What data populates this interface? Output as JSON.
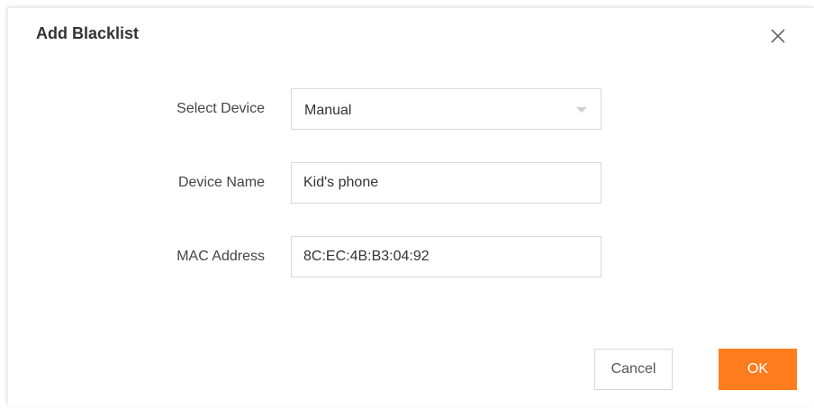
{
  "dialog": {
    "title": "Add Blacklist",
    "close_icon": "close-icon"
  },
  "form": {
    "select_device": {
      "label": "Select Device",
      "value": "Manual",
      "icon": "chevron-down-icon"
    },
    "device_name": {
      "label": "Device Name",
      "value": "Kid's phone"
    },
    "mac_address": {
      "label": "MAC Address",
      "value": "8C:EC:4B:B3:04:92"
    }
  },
  "actions": {
    "cancel_label": "Cancel",
    "ok_label": "OK"
  },
  "colors": {
    "accent": "#ff7d1f",
    "border": "#d9d9d9",
    "text": "#333333"
  }
}
